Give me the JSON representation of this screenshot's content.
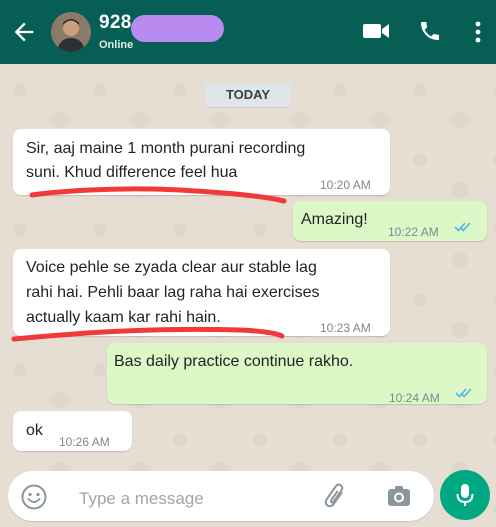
{
  "header": {
    "contact_name": "928",
    "status": "Online",
    "back_icon": "arrow-left-icon",
    "video_icon": "video-call-icon",
    "phone_icon": "phone-icon",
    "menu_icon": "more-vertical-icon"
  },
  "date_chip": "TODAY",
  "messages": [
    {
      "direction": "in",
      "text": "Sir, aaj maine 1 month purani recording\nsuni. Khud difference feel hua",
      "time": "10:20 AM"
    },
    {
      "direction": "out",
      "text": "Amazing!",
      "time": "10:22 AM",
      "read": true
    },
    {
      "direction": "in",
      "text": "Voice pehle se zyada clear aur stable lag\nrahi hai. Pehli baar lag raha hai exercises\nactually kaam kar rahi hain.",
      "time": "10:23 AM"
    },
    {
      "direction": "out",
      "text": "Bas daily practice continue rakho.",
      "time": "10:24 AM",
      "read": true
    },
    {
      "direction": "in",
      "text": "ok",
      "time": "10:26 AM"
    }
  ],
  "composer": {
    "placeholder": "Type a message",
    "emoji_icon": "emoji-icon",
    "attach_icon": "paperclip-icon",
    "camera_icon": "camera-icon",
    "mic_icon": "mic-icon"
  },
  "colors": {
    "header": "#075e54",
    "outgoing_bubble": "#dcf8c6",
    "incoming_bubble": "#ffffff",
    "mic_button": "#00a884",
    "read_ticks": "#4fb6ec",
    "annotation_underline": "#f03a3a",
    "name_redaction": "#b98af0"
  }
}
